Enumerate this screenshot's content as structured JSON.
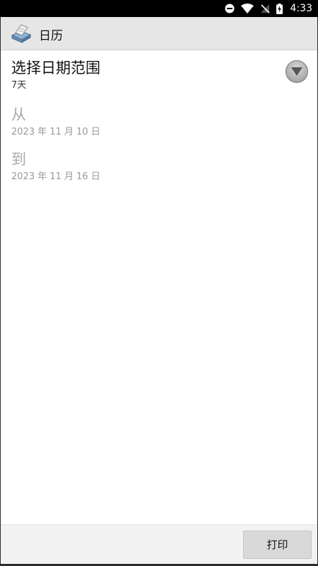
{
  "status_bar": {
    "time": "4:33"
  },
  "app_bar": {
    "title": "日历"
  },
  "range": {
    "title": "选择日期范围",
    "value": "7天"
  },
  "from": {
    "label": "从",
    "date": "2023 年 11 月 10 日"
  },
  "to": {
    "label": "到",
    "date": "2023 年 11 月 16 日"
  },
  "bottom_bar": {
    "print_label": "打印"
  }
}
